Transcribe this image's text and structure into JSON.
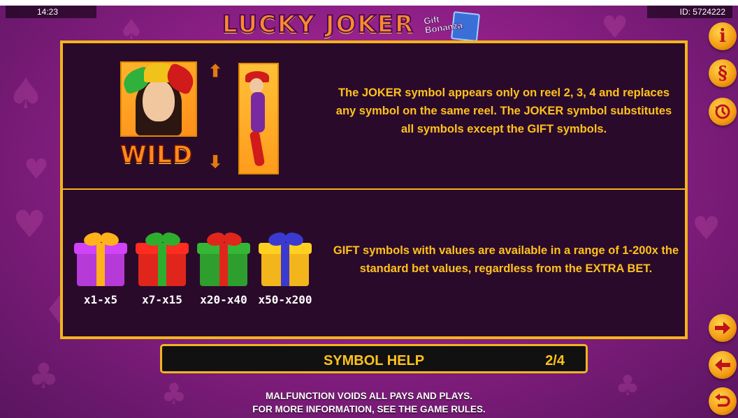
{
  "status": {
    "time": "14:23",
    "game_id": "ID: 5724222"
  },
  "logo": {
    "title": "LUCKY JOKER",
    "subtitle_line1": "Gift",
    "subtitle_line2": "Bonanza"
  },
  "side_buttons": {
    "info_icon": "i",
    "rules_icon": "§",
    "history_icon": "history-icon",
    "next_icon": "arrow-right-icon",
    "prev_icon": "arrow-left-icon",
    "back_icon": "return-icon"
  },
  "wild_section": {
    "label": "WILD",
    "text": "The JOKER symbol appears only on reel 2, 3, 4 and replaces any symbol on the same reel. The JOKER symbol substitutes all symbols except the GIFT symbols."
  },
  "gift_section": {
    "gifts": [
      {
        "label": "x1-x5",
        "box_color": "#b53ad8",
        "ribbon_color": "#ffb21a"
      },
      {
        "label": "x7-x15",
        "box_color": "#e0261c",
        "ribbon_color": "#2eae2e"
      },
      {
        "label": "x20-x40",
        "box_color": "#2e9e2e",
        "ribbon_color": "#e0261c"
      },
      {
        "label": "x50-x200",
        "box_color": "#f3b51c",
        "ribbon_color": "#3a3ad0"
      }
    ],
    "text": "GIFT symbols with values are available in a range of 1-200x the standard bet values, regardless from the EXTRA BET."
  },
  "footer": {
    "title": "SYMBOL HELP",
    "page": "2/4"
  },
  "disclaimer": {
    "line1": "MALFUNCTION VOIDS ALL PAYS AND PLAYS.",
    "line2": "FOR MORE INFORMATION, SEE THE GAME RULES."
  },
  "colors": {
    "accent": "#f3b51c",
    "text_gold": "#ffc21c",
    "panel_bg": "#2a0a2a"
  }
}
